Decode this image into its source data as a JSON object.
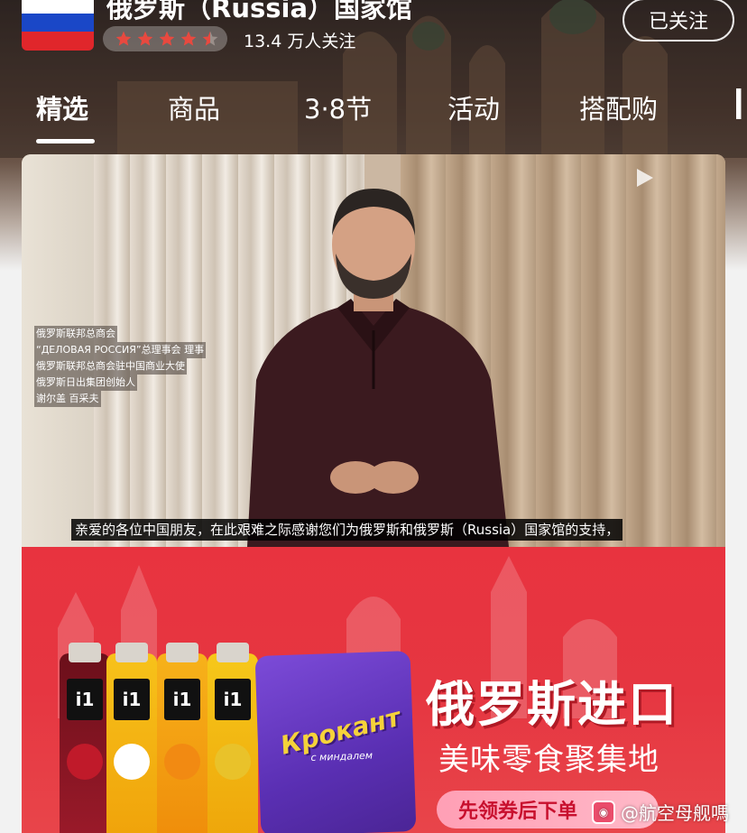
{
  "store": {
    "name": "俄罗斯（Russia）国家馆",
    "followers": "13.4 万人关注",
    "follow_button": "已关注",
    "rating_stars": 4.5
  },
  "tabs": [
    {
      "label": "精选",
      "active": true
    },
    {
      "label": "商品",
      "active": false
    },
    {
      "label": "3·8节",
      "active": false
    },
    {
      "label": "活动",
      "active": false
    },
    {
      "label": "搭配购",
      "active": false
    }
  ],
  "video": {
    "caption_lines": [
      "俄罗斯联邦总商会",
      "“ДЕЛОВАЯ РОССИЯ”总理事会 理事",
      "俄罗斯联邦总商会驻中国商业大使",
      "俄罗斯日出集团创始人",
      "谢尔盖 百采夫"
    ],
    "subtitle": "亲爱的各位中国朋友，在此艰难之际感谢您们为俄罗斯和俄罗斯（Russia）国家馆的支持，"
  },
  "banner": {
    "title": "俄罗斯进口",
    "subtitle": "美味零食聚集地",
    "coupon": "先领券后下单",
    "candy_brand": "Крокант",
    "candy_sub": "с миндалем",
    "juice_brand": "i1"
  },
  "watermark": "@航空母舰嗎",
  "colors": {
    "banner_red": "#e63641",
    "flag_white": "#ffffff",
    "flag_blue": "#1a47c7",
    "flag_red": "#e0262b",
    "star": "#e8493f"
  }
}
